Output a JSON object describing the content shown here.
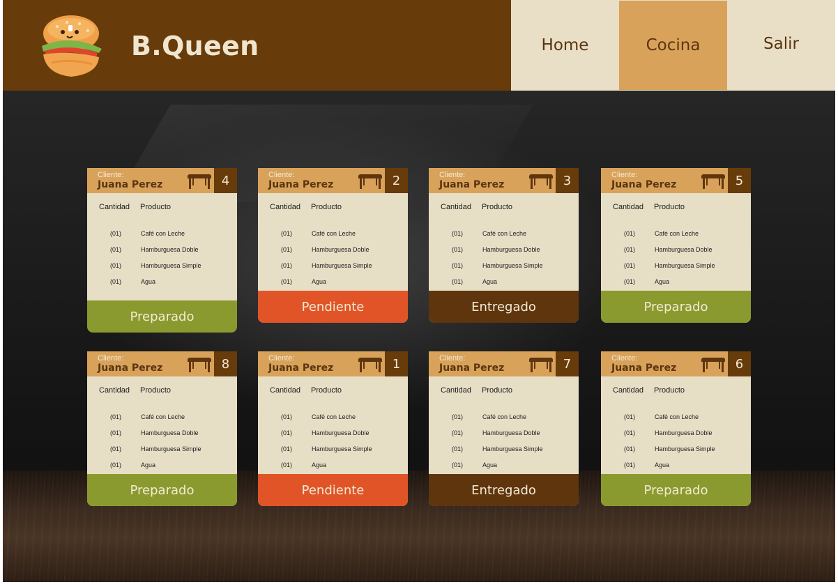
{
  "header": {
    "brand": "B.Queen",
    "nav": [
      "Home",
      "Cocina",
      "Salir"
    ]
  },
  "colors": {
    "header_bg": "#673b0a",
    "nav_bg": "#e8dfc6",
    "nav_active": "#d9a25a",
    "card_bg": "#e7dec6",
    "card_head": "#d9a25a",
    "preparado": "#8a9a2e",
    "pendiente": "#e15427",
    "entregado": "#5e350d"
  },
  "column_headers": {
    "qty": "Cantidad",
    "product": "Producto"
  },
  "orders": [
    {
      "client_label": "Cliente:",
      "client": "Juana Perez",
      "table": "4",
      "status": "Preparado",
      "status_key": "preparado",
      "items": [
        {
          "qty": "(01)",
          "product": "Café con Leche"
        },
        {
          "qty": "(01)",
          "product": "Hamburguesa Doble"
        },
        {
          "qty": "(01)",
          "product": "Hamburguesa Simple"
        },
        {
          "qty": "(01)",
          "product": "Agua"
        }
      ]
    },
    {
      "client_label": "Cliente:",
      "client": "Juana Perez",
      "table": "2",
      "status": "Pendiente",
      "status_key": "pendiente",
      "items": [
        {
          "qty": "(01)",
          "product": "Café con Leche"
        },
        {
          "qty": "(01)",
          "product": "Hamburguesa Doble"
        },
        {
          "qty": "(01)",
          "product": "Hamburguesa Simple"
        },
        {
          "qty": "(01)",
          "product": "Agua"
        }
      ]
    },
    {
      "client_label": "Cliente:",
      "client": "Juana Perez",
      "table": "3",
      "status": "Entregado",
      "status_key": "entregado",
      "items": [
        {
          "qty": "(01)",
          "product": "Café con Leche"
        },
        {
          "qty": "(01)",
          "product": "Hamburguesa Doble"
        },
        {
          "qty": "(01)",
          "product": "Hamburguesa Simple"
        },
        {
          "qty": "(01)",
          "product": "Agua"
        }
      ]
    },
    {
      "client_label": "Cliente:",
      "client": "Juana Perez",
      "table": "5",
      "status": "Preparado",
      "status_key": "preparado",
      "items": [
        {
          "qty": "(01)",
          "product": "Café con Leche"
        },
        {
          "qty": "(01)",
          "product": "Hamburguesa Doble"
        },
        {
          "qty": "(01)",
          "product": "Hamburguesa Simple"
        },
        {
          "qty": "(01)",
          "product": "Agua"
        }
      ]
    },
    {
      "client_label": "Cliente:",
      "client": "Juana Perez",
      "table": "8",
      "status": "Preparado",
      "status_key": "preparado",
      "items": [
        {
          "qty": "(01)",
          "product": "Café con Leche"
        },
        {
          "qty": "(01)",
          "product": "Hamburguesa Doble"
        },
        {
          "qty": "(01)",
          "product": "Hamburguesa Simple"
        },
        {
          "qty": "(01)",
          "product": "Agua"
        }
      ]
    },
    {
      "client_label": "Cliente:",
      "client": "Juana Perez",
      "table": "1",
      "status": "Pendiente",
      "status_key": "pendiente",
      "items": [
        {
          "qty": "(01)",
          "product": "Café con Leche"
        },
        {
          "qty": "(01)",
          "product": "Hamburguesa Doble"
        },
        {
          "qty": "(01)",
          "product": "Hamburguesa Simple"
        },
        {
          "qty": "(01)",
          "product": "Agua"
        }
      ]
    },
    {
      "client_label": "Cliente:",
      "client": "Juana Perez",
      "table": "7",
      "status": "Entregado",
      "status_key": "entregado",
      "items": [
        {
          "qty": "(01)",
          "product": "Café con Leche"
        },
        {
          "qty": "(01)",
          "product": "Hamburguesa Doble"
        },
        {
          "qty": "(01)",
          "product": "Hamburguesa Simple"
        },
        {
          "qty": "(01)",
          "product": "Agua"
        }
      ]
    },
    {
      "client_label": "Cliente:",
      "client": "Juana Perez",
      "table": "6",
      "status": "Preparado",
      "status_key": "preparado",
      "items": [
        {
          "qty": "(01)",
          "product": "Café con Leche"
        },
        {
          "qty": "(01)",
          "product": "Hamburguesa Doble"
        },
        {
          "qty": "(01)",
          "product": "Hamburguesa Simple"
        },
        {
          "qty": "(01)",
          "product": "Agua"
        }
      ]
    }
  ]
}
